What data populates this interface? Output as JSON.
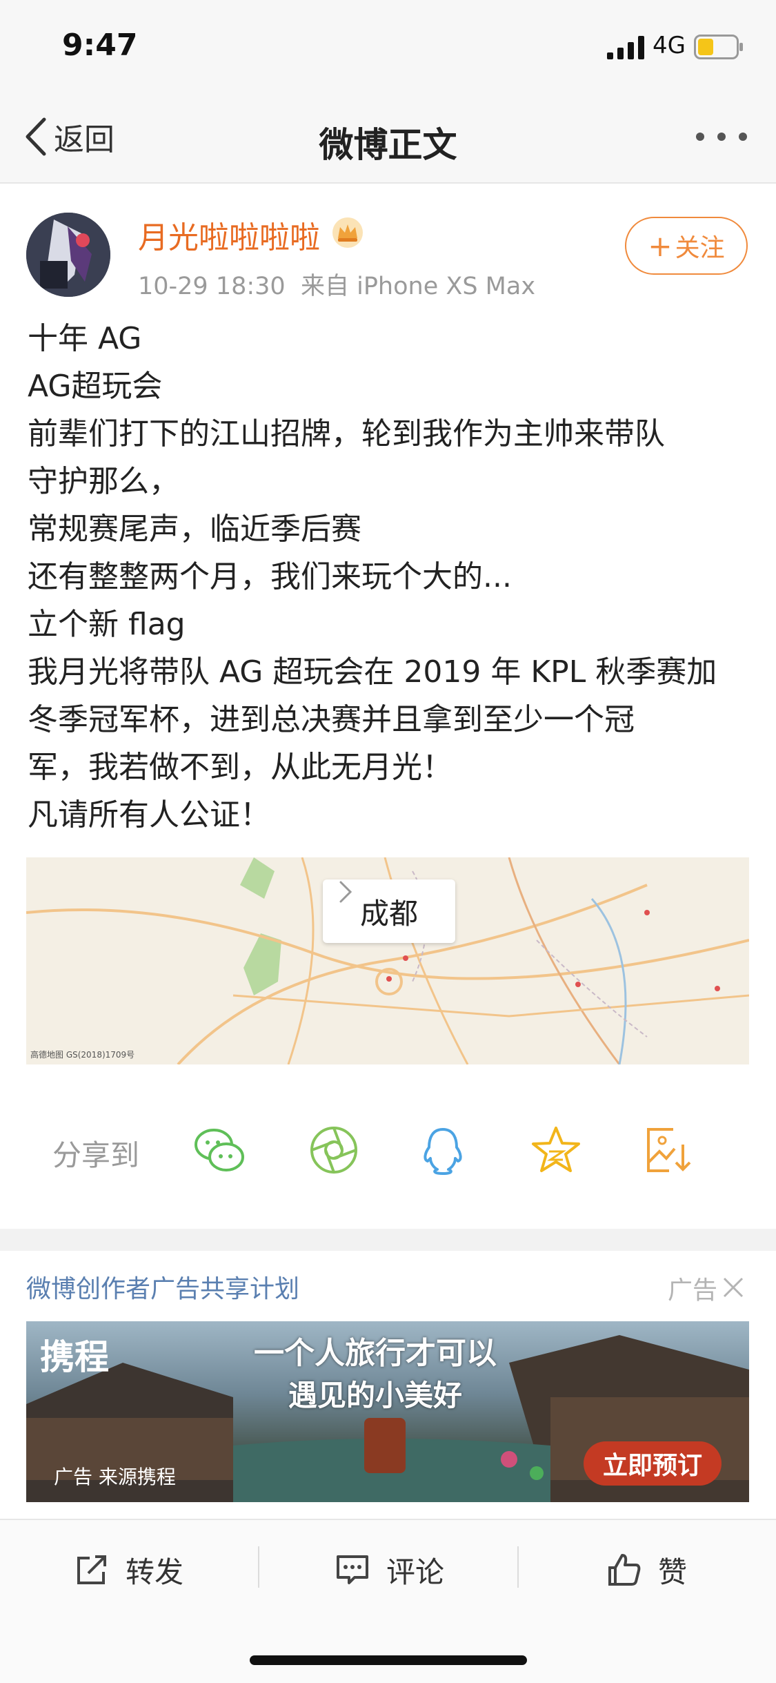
{
  "status_bar": {
    "time": "9:47",
    "network": "4G"
  },
  "nav": {
    "back_label": "返回",
    "title": "微博正文"
  },
  "post": {
    "username": "月光啦啦啦啦",
    "timestamp": "10-29 18:30",
    "source": "来自 iPhone XS Max",
    "follow_label": "关注",
    "lines": [
      "十年 AG",
      "AG超玩会",
      "前辈们打下的江山招牌，轮到我作为主帅来带队",
      "守护那么，",
      "常规赛尾声，临近季后赛",
      "还有整整两个月，我们来玩个大的...",
      "立个新 flag",
      "我月光将带队 AG 超玩会在 2019 年 KPL 秋季赛加",
      "冬季冠军杯，进到总决赛并且拿到至少一个冠",
      "军，我若做不到，从此无月光！",
      "凡请所有人公证！"
    ],
    "location": "成都",
    "map_credit": "高德地图 GS(2018)1709号"
  },
  "share": {
    "label": "分享到"
  },
  "ad": {
    "title": "微博创作者广告共享计划",
    "tag": "广告",
    "logo": "携程",
    "slogan_line1": "一个人旅行才可以",
    "slogan_line2": "遇见的小美好",
    "cta": "立即预订",
    "source": "广告 来源携程"
  },
  "actions": {
    "repost": "转发",
    "comment": "评论",
    "like": "赞"
  },
  "colors": {
    "accent_orange": "#f08a3c",
    "username": "#e86b22",
    "link_blue": "#5a7fb0"
  }
}
